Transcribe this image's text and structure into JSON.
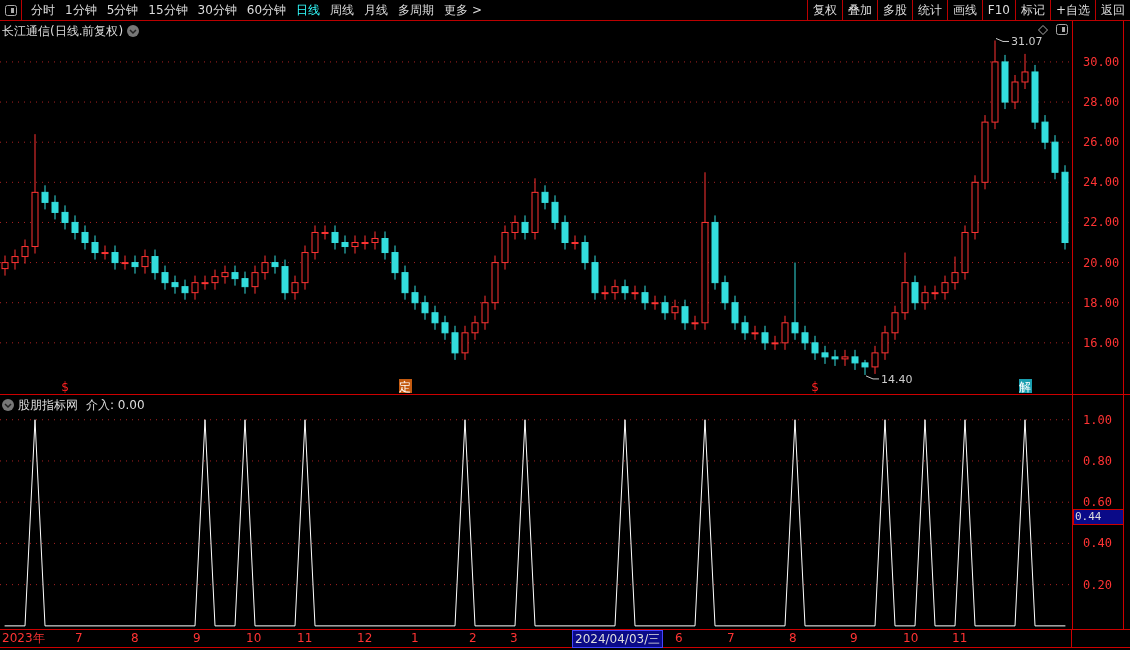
{
  "toolbar": {
    "periods": [
      {
        "label": "分时",
        "selected": false
      },
      {
        "label": "1分钟",
        "selected": false
      },
      {
        "label": "5分钟",
        "selected": false
      },
      {
        "label": "15分钟",
        "selected": false
      },
      {
        "label": "30分钟",
        "selected": false
      },
      {
        "label": "60分钟",
        "selected": false
      },
      {
        "label": "日线",
        "selected": true
      },
      {
        "label": "周线",
        "selected": false
      },
      {
        "label": "月线",
        "selected": false
      },
      {
        "label": "多周期",
        "selected": false
      },
      {
        "label": "更多 >",
        "selected": false
      }
    ],
    "actions": [
      "复权",
      "叠加",
      "多股",
      "统计",
      "画线",
      "F10",
      "标记",
      "+自选",
      "返回"
    ]
  },
  "price_panel": {
    "title": "长江通信(日线.前复权)",
    "high_label": "31.07",
    "low_label": "14.40",
    "markers": [
      {
        "kind": "dollar",
        "text": "$"
      },
      {
        "kind": "ding",
        "text": "定"
      },
      {
        "kind": "dollar",
        "text": "$"
      },
      {
        "kind": "jie",
        "text": "解"
      }
    ],
    "chart_data": {
      "type": "candlestick",
      "grid": true,
      "ylim": [
        13.4,
        32.04
      ],
      "yticks": [
        {
          "value": 16,
          "label": "16.00"
        },
        {
          "value": 18,
          "label": "18.00"
        },
        {
          "value": 20,
          "label": "20.00"
        },
        {
          "value": 22,
          "label": "22.00"
        },
        {
          "value": 24,
          "label": "24.00"
        },
        {
          "value": 26,
          "label": "26.00"
        },
        {
          "value": 28,
          "label": "28.00"
        },
        {
          "value": 30,
          "label": "30.00"
        }
      ],
      "ohlc": [
        [
          19.7,
          20.35,
          19.35,
          20
        ],
        [
          20,
          20.65,
          19.65,
          20.3
        ],
        [
          20.3,
          21.15,
          19.95,
          20.8
        ],
        [
          20.8,
          26.4,
          20.45,
          23.5
        ],
        [
          23.5,
          23.85,
          22.65,
          23
        ],
        [
          23,
          23.35,
          22.15,
          22.5
        ],
        [
          22.5,
          22.85,
          21.65,
          22
        ],
        [
          22,
          22.35,
          21.15,
          21.5
        ],
        [
          21.5,
          21.85,
          20.65,
          21
        ],
        [
          21,
          21.35,
          20.15,
          20.5
        ],
        [
          20.5,
          20.85,
          20.15,
          20.5
        ],
        [
          20.5,
          20.85,
          19.65,
          20
        ],
        [
          20,
          20.35,
          19.65,
          20
        ],
        [
          20,
          20.35,
          19.45,
          19.8
        ],
        [
          19.8,
          20.65,
          19.45,
          20.3
        ],
        [
          20.3,
          20.65,
          19.15,
          19.5
        ],
        [
          19.5,
          19.85,
          18.65,
          19
        ],
        [
          19,
          19.35,
          18.45,
          18.8
        ],
        [
          18.8,
          19.15,
          18.15,
          18.5
        ],
        [
          18.5,
          19.35,
          18.15,
          19
        ],
        [
          19,
          19.35,
          18.65,
          19
        ],
        [
          19,
          19.65,
          18.65,
          19.3
        ],
        [
          19.3,
          19.85,
          18.95,
          19.5
        ],
        [
          19.5,
          19.85,
          18.85,
          19.2
        ],
        [
          19.2,
          19.55,
          18.45,
          18.8
        ],
        [
          18.8,
          19.85,
          18.45,
          19.5
        ],
        [
          19.5,
          20.35,
          19.15,
          20
        ],
        [
          20,
          20.35,
          19.45,
          19.8
        ],
        [
          19.8,
          20.15,
          18.15,
          18.5
        ],
        [
          18.5,
          19.35,
          18.15,
          19
        ],
        [
          19,
          20.85,
          18.65,
          20.5
        ],
        [
          20.5,
          21.85,
          20.15,
          21.5
        ],
        [
          21.5,
          21.85,
          21.15,
          21.5
        ],
        [
          21.5,
          21.85,
          20.65,
          21
        ],
        [
          21,
          21.35,
          20.45,
          20.8
        ],
        [
          20.8,
          21.35,
          20.45,
          21
        ],
        [
          21,
          21.35,
          20.65,
          21
        ],
        [
          21,
          21.55,
          20.65,
          21.2
        ],
        [
          21.2,
          21.55,
          20.15,
          20.5
        ],
        [
          20.5,
          20.85,
          19.15,
          19.5
        ],
        [
          19.5,
          19.85,
          18.15,
          18.5
        ],
        [
          18.5,
          18.85,
          17.65,
          18
        ],
        [
          18,
          18.35,
          17.15,
          17.5
        ],
        [
          17.5,
          17.85,
          16.65,
          17
        ],
        [
          17,
          17.35,
          16.15,
          16.5
        ],
        [
          16.5,
          16.85,
          15.15,
          15.5
        ],
        [
          15.5,
          16.85,
          15.15,
          16.5
        ],
        [
          16.5,
          17.35,
          16.15,
          17
        ],
        [
          17,
          18.35,
          16.65,
          18
        ],
        [
          18,
          20.35,
          17.65,
          20
        ],
        [
          20,
          21.85,
          19.65,
          21.5
        ],
        [
          21.5,
          22.35,
          21.15,
          22
        ],
        [
          22,
          22.35,
          21.15,
          21.5
        ],
        [
          21.5,
          24.2,
          21.15,
          23.5
        ],
        [
          23.5,
          23.85,
          22.65,
          23
        ],
        [
          23,
          23.35,
          21.65,
          22
        ],
        [
          22,
          22.35,
          20.65,
          21
        ],
        [
          21,
          21.35,
          20.65,
          21
        ],
        [
          21,
          21.35,
          19.65,
          20
        ],
        [
          20,
          20.35,
          18.15,
          18.5
        ],
        [
          18.5,
          18.85,
          18.15,
          18.5
        ],
        [
          18.5,
          19.15,
          18.15,
          18.8
        ],
        [
          18.8,
          19.15,
          18.15,
          18.5
        ],
        [
          18.5,
          18.85,
          18.15,
          18.5
        ],
        [
          18.5,
          18.85,
          17.65,
          18
        ],
        [
          18,
          18.35,
          17.65,
          18
        ],
        [
          18,
          18.35,
          17.15,
          17.5
        ],
        [
          17.5,
          18.15,
          17.15,
          17.8
        ],
        [
          17.8,
          18.15,
          16.65,
          17
        ],
        [
          17,
          17.35,
          16.65,
          17
        ],
        [
          17,
          24.5,
          16.65,
          22
        ],
        [
          22,
          22.35,
          18.65,
          19
        ],
        [
          19,
          19.35,
          17.65,
          18
        ],
        [
          18,
          18.35,
          16.65,
          17
        ],
        [
          17,
          17.35,
          16.15,
          16.5
        ],
        [
          16.5,
          16.85,
          16.15,
          16.5
        ],
        [
          16.5,
          16.85,
          15.65,
          16
        ],
        [
          16,
          16.35,
          15.65,
          16
        ],
        [
          16,
          17.35,
          15.65,
          17
        ],
        [
          17,
          20,
          16.15,
          16.5
        ],
        [
          16.5,
          16.85,
          15.65,
          16
        ],
        [
          16,
          16.35,
          15.15,
          15.5
        ],
        [
          15.5,
          15.85,
          14.95,
          15.3
        ],
        [
          15.3,
          15.65,
          14.85,
          15.2
        ],
        [
          15.2,
          15.65,
          14.85,
          15.3
        ],
        [
          15.3,
          15.65,
          14.65,
          15
        ],
        [
          15,
          15.15,
          14.4,
          14.8
        ],
        [
          14.8,
          15.85,
          14.45,
          15.5
        ],
        [
          15.5,
          16.85,
          15.15,
          16.5
        ],
        [
          16.5,
          17.85,
          16.15,
          17.5
        ],
        [
          17.5,
          20.5,
          17.15,
          19
        ],
        [
          19,
          19.35,
          17.65,
          18
        ],
        [
          18,
          18.85,
          17.65,
          18.5
        ],
        [
          18.5,
          18.85,
          18.15,
          18.5
        ],
        [
          18.5,
          19.35,
          18.15,
          19
        ],
        [
          19,
          20.3,
          18.65,
          19.5
        ],
        [
          19.5,
          21.85,
          19.15,
          21.5
        ],
        [
          21.5,
          24.35,
          21.15,
          24
        ],
        [
          24,
          27.35,
          23.65,
          27
        ],
        [
          27,
          31.07,
          26.65,
          30
        ],
        [
          30,
          30.35,
          27.65,
          28
        ],
        [
          28,
          29.35,
          27.65,
          29
        ],
        [
          29,
          30.4,
          28.65,
          29.5
        ],
        [
          29.5,
          29.85,
          26.65,
          27
        ],
        [
          27,
          27.35,
          25.65,
          26
        ],
        [
          26,
          26.35,
          24.15,
          24.5
        ],
        [
          24.5,
          24.85,
          20.65,
          21
        ]
      ]
    }
  },
  "indicator_panel": {
    "title": "股朋指标网",
    "reading": "介入: 0.00",
    "cursor_value": "0.44",
    "chart_data": {
      "type": "line",
      "grid": true,
      "ylim": [
        -0.02,
        1.12
      ],
      "yticks": [
        {
          "value": 0.2,
          "label": "0.20"
        },
        {
          "value": 0.4,
          "label": "0.40"
        },
        {
          "value": 0.6,
          "label": "0.60"
        },
        {
          "value": 0.8,
          "label": "0.80"
        },
        {
          "value": 1,
          "label": "1.00"
        }
      ],
      "series": [
        {
          "values": [
            0,
            0,
            0,
            1,
            0,
            0,
            0,
            0,
            0,
            0,
            0,
            0,
            0,
            0,
            0,
            0,
            0,
            0,
            0,
            0,
            1,
            0,
            0,
            0,
            1,
            0,
            0,
            0,
            0,
            0,
            1,
            0,
            0,
            0,
            0,
            0,
            0,
            0,
            0,
            0,
            0,
            0,
            0,
            0,
            0,
            0,
            1,
            0,
            0,
            0,
            0,
            0,
            1,
            0,
            0,
            0,
            0,
            0,
            0,
            0,
            0,
            0,
            1,
            0,
            0,
            0,
            0,
            0,
            0,
            0,
            1,
            0,
            0,
            0,
            0,
            0,
            0,
            0,
            0,
            1,
            0,
            0,
            0,
            0,
            0,
            0,
            0,
            0,
            1,
            0,
            0,
            0,
            1,
            0,
            0,
            0,
            1,
            0,
            0,
            0,
            0,
            0,
            1,
            0,
            0,
            0,
            0
          ]
        }
      ]
    }
  },
  "time_axis": [
    {
      "kind": "year",
      "label": "2023年"
    },
    {
      "kind": "month",
      "label": "7"
    },
    {
      "kind": "month",
      "label": "8"
    },
    {
      "kind": "month",
      "label": "9"
    },
    {
      "kind": "month",
      "label": "10"
    },
    {
      "kind": "month",
      "label": "11"
    },
    {
      "kind": "month",
      "label": "12"
    },
    {
      "kind": "month",
      "label": "1"
    },
    {
      "kind": "month",
      "label": "2"
    },
    {
      "kind": "month",
      "label": "3"
    },
    {
      "kind": "cursor",
      "label": "2024/04/03/三"
    },
    {
      "kind": "month",
      "label": "6"
    },
    {
      "kind": "month",
      "label": "7"
    },
    {
      "kind": "month",
      "label": "8"
    },
    {
      "kind": "month",
      "label": "9"
    },
    {
      "kind": "month",
      "label": "10"
    },
    {
      "kind": "month",
      "label": "11"
    }
  ]
}
